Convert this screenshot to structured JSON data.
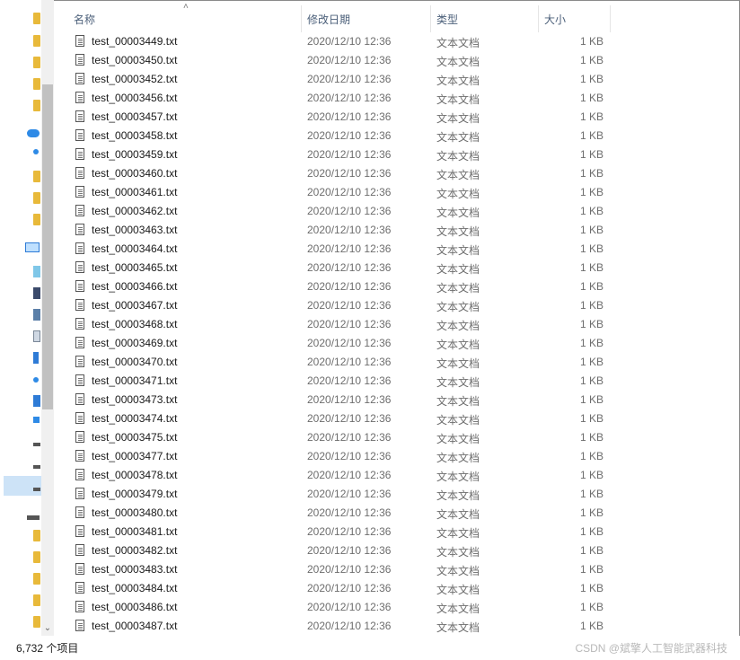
{
  "columns": {
    "name": "名称",
    "date": "修改日期",
    "type": "类型",
    "size": "大小"
  },
  "files": [
    {
      "name": "test_00003449.txt",
      "date": "2020/12/10 12:36",
      "type": "文本文档",
      "size": "1 KB"
    },
    {
      "name": "test_00003450.txt",
      "date": "2020/12/10 12:36",
      "type": "文本文档",
      "size": "1 KB"
    },
    {
      "name": "test_00003452.txt",
      "date": "2020/12/10 12:36",
      "type": "文本文档",
      "size": "1 KB"
    },
    {
      "name": "test_00003456.txt",
      "date": "2020/12/10 12:36",
      "type": "文本文档",
      "size": "1 KB"
    },
    {
      "name": "test_00003457.txt",
      "date": "2020/12/10 12:36",
      "type": "文本文档",
      "size": "1 KB"
    },
    {
      "name": "test_00003458.txt",
      "date": "2020/12/10 12:36",
      "type": "文本文档",
      "size": "1 KB"
    },
    {
      "name": "test_00003459.txt",
      "date": "2020/12/10 12:36",
      "type": "文本文档",
      "size": "1 KB"
    },
    {
      "name": "test_00003460.txt",
      "date": "2020/12/10 12:36",
      "type": "文本文档",
      "size": "1 KB"
    },
    {
      "name": "test_00003461.txt",
      "date": "2020/12/10 12:36",
      "type": "文本文档",
      "size": "1 KB"
    },
    {
      "name": "test_00003462.txt",
      "date": "2020/12/10 12:36",
      "type": "文本文档",
      "size": "1 KB"
    },
    {
      "name": "test_00003463.txt",
      "date": "2020/12/10 12:36",
      "type": "文本文档",
      "size": "1 KB"
    },
    {
      "name": "test_00003464.txt",
      "date": "2020/12/10 12:36",
      "type": "文本文档",
      "size": "1 KB"
    },
    {
      "name": "test_00003465.txt",
      "date": "2020/12/10 12:36",
      "type": "文本文档",
      "size": "1 KB"
    },
    {
      "name": "test_00003466.txt",
      "date": "2020/12/10 12:36",
      "type": "文本文档",
      "size": "1 KB"
    },
    {
      "name": "test_00003467.txt",
      "date": "2020/12/10 12:36",
      "type": "文本文档",
      "size": "1 KB"
    },
    {
      "name": "test_00003468.txt",
      "date": "2020/12/10 12:36",
      "type": "文本文档",
      "size": "1 KB"
    },
    {
      "name": "test_00003469.txt",
      "date": "2020/12/10 12:36",
      "type": "文本文档",
      "size": "1 KB"
    },
    {
      "name": "test_00003470.txt",
      "date": "2020/12/10 12:36",
      "type": "文本文档",
      "size": "1 KB"
    },
    {
      "name": "test_00003471.txt",
      "date": "2020/12/10 12:36",
      "type": "文本文档",
      "size": "1 KB"
    },
    {
      "name": "test_00003473.txt",
      "date": "2020/12/10 12:36",
      "type": "文本文档",
      "size": "1 KB"
    },
    {
      "name": "test_00003474.txt",
      "date": "2020/12/10 12:36",
      "type": "文本文档",
      "size": "1 KB"
    },
    {
      "name": "test_00003475.txt",
      "date": "2020/12/10 12:36",
      "type": "文本文档",
      "size": "1 KB"
    },
    {
      "name": "test_00003477.txt",
      "date": "2020/12/10 12:36",
      "type": "文本文档",
      "size": "1 KB"
    },
    {
      "name": "test_00003478.txt",
      "date": "2020/12/10 12:36",
      "type": "文本文档",
      "size": "1 KB"
    },
    {
      "name": "test_00003479.txt",
      "date": "2020/12/10 12:36",
      "type": "文本文档",
      "size": "1 KB"
    },
    {
      "name": "test_00003480.txt",
      "date": "2020/12/10 12:36",
      "type": "文本文档",
      "size": "1 KB"
    },
    {
      "name": "test_00003481.txt",
      "date": "2020/12/10 12:36",
      "type": "文本文档",
      "size": "1 KB"
    },
    {
      "name": "test_00003482.txt",
      "date": "2020/12/10 12:36",
      "type": "文本文档",
      "size": "1 KB"
    },
    {
      "name": "test_00003483.txt",
      "date": "2020/12/10 12:36",
      "type": "文本文档",
      "size": "1 KB"
    },
    {
      "name": "test_00003484.txt",
      "date": "2020/12/10 12:36",
      "type": "文本文档",
      "size": "1 KB"
    },
    {
      "name": "test_00003486.txt",
      "date": "2020/12/10 12:36",
      "type": "文本文档",
      "size": "1 KB"
    },
    {
      "name": "test_00003487.txt",
      "date": "2020/12/10 12:36",
      "type": "文本文档",
      "size": "1 KB"
    }
  ],
  "status": {
    "item_count": "6,732 个项目",
    "watermark": "CSDN @斌擎人工智能武器科技"
  },
  "icons": {
    "file": "text-file-icon",
    "sort": "sort-ascending-icon"
  },
  "colors": {
    "folder": "#e8b93a",
    "header_text": "#4c607a",
    "selection": "#cde3f7"
  }
}
